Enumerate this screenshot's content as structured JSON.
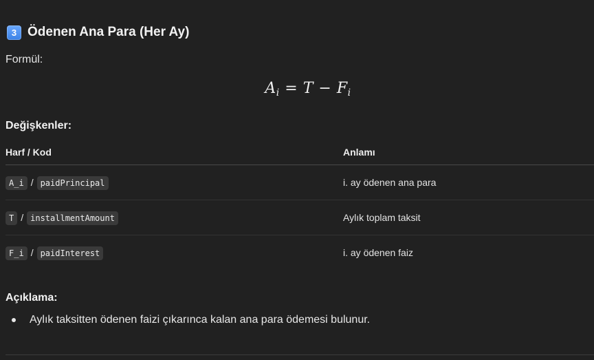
{
  "section": {
    "number_icon": "keycap-3-icon",
    "number_label": "3",
    "title": "Ödenen Ana Para (Her Ay)",
    "accent_color": "#4f93f2"
  },
  "formula": {
    "label": "Formül:",
    "lhs": "A",
    "lhs_sub": "i",
    "equals": "=",
    "term1": "T",
    "minus": "−",
    "term2": "F",
    "term2_sub": "i"
  },
  "variables": {
    "heading": "Değişkenler:",
    "columns": [
      "Harf / Kod",
      "Anlamı"
    ],
    "rows": [
      {
        "letter": "A_i",
        "code": "paidPrincipal",
        "meaning": "i. ay ödenen ana para"
      },
      {
        "letter": "T",
        "code": "installmentAmount",
        "meaning": "Aylık toplam taksit"
      },
      {
        "letter": "F_i",
        "code": "paidInterest",
        "meaning": "i. ay ödenen faiz"
      }
    ],
    "separator": "/"
  },
  "explanation": {
    "heading": "Açıklama:",
    "items": [
      "Aylık taksitten ödenen faizi çıkarınca kalan ana para ödemesi bulunur."
    ]
  }
}
